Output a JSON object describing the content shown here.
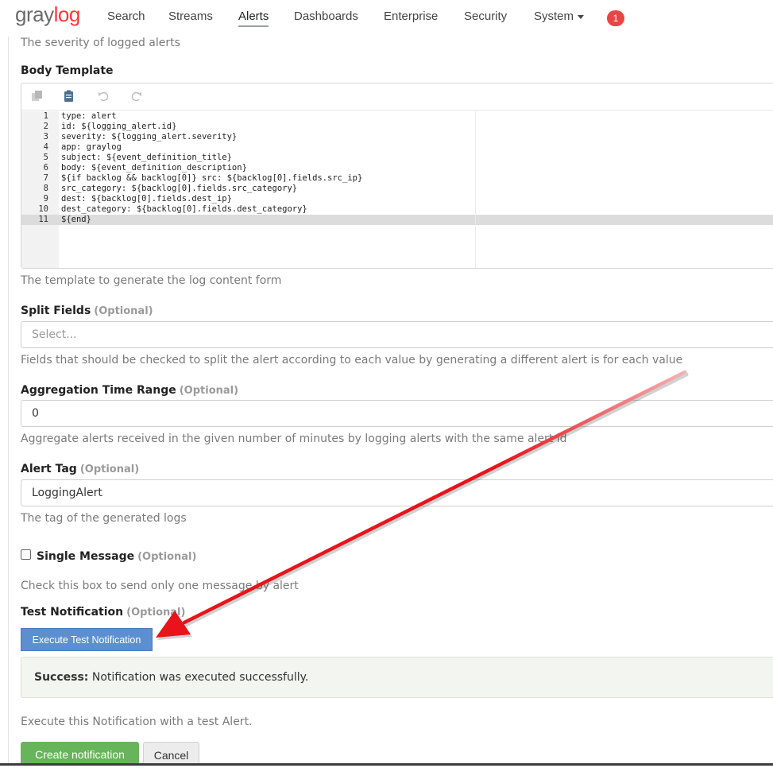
{
  "nav": {
    "logo_gray": "gray",
    "logo_log": "log",
    "items": [
      "Search",
      "Streams",
      "Alerts",
      "Dashboards",
      "Enterprise",
      "Security",
      "System"
    ],
    "notification_count": "1"
  },
  "severity": {
    "help": "The severity of logged alerts"
  },
  "body_template": {
    "label": "Body Template",
    "help": "The template to generate the log content form",
    "line_numbers": [
      "1",
      "2",
      "3",
      "4",
      "5",
      "6",
      "7",
      "8",
      "9",
      "10",
      "11"
    ],
    "lines": [
      "type: alert",
      "id: ${logging_alert.id}",
      "severity: ${logging_alert.severity}",
      "app: graylog",
      "subject: ${event_definition_title}",
      "body: ${event_definition_description}",
      "${if backlog && backlog[0]} src: ${backlog[0].fields.src_ip}",
      "src_category: ${backlog[0].fields.src_category}",
      "dest: ${backlog[0].fields.dest_ip}",
      "dest_category: ${backlog[0].fields.dest_category}",
      "${end}"
    ],
    "toolbar_icons": [
      "copy-icon",
      "paste-icon",
      "undo-icon",
      "redo-icon"
    ]
  },
  "split_fields": {
    "label": "Split Fields",
    "optional": "(Optional)",
    "placeholder": "Select...",
    "help": "Fields that should be checked to split the alert according to each value by generating a different alert is for each value"
  },
  "aggregation": {
    "label": "Aggregation Time Range",
    "optional": "(Optional)",
    "value": "0",
    "help": "Aggregate alerts received in the given number of minutes by logging alerts with the same alert id"
  },
  "alert_tag": {
    "label": "Alert Tag",
    "optional": "(Optional)",
    "value": "LoggingAlert",
    "help": "The tag of the generated logs"
  },
  "single_message": {
    "label": "Single Message",
    "optional": "(Optional)",
    "checked": false,
    "help": "Check this box to send only one message by alert"
  },
  "test_notification": {
    "label": "Test Notification",
    "optional": "(Optional)",
    "button": "Execute Test Notification",
    "success_strong": "Success:",
    "success_text": "Notification was executed successfully.",
    "help": "Execute this Notification with a test Alert."
  },
  "footer": {
    "create": "Create notification",
    "cancel": "Cancel"
  },
  "colors": {
    "logo_accent": "#ff3633",
    "primary_button": "#5b8fd1",
    "success_button": "#67b45a",
    "annotation_arrow": "#e8141a"
  }
}
